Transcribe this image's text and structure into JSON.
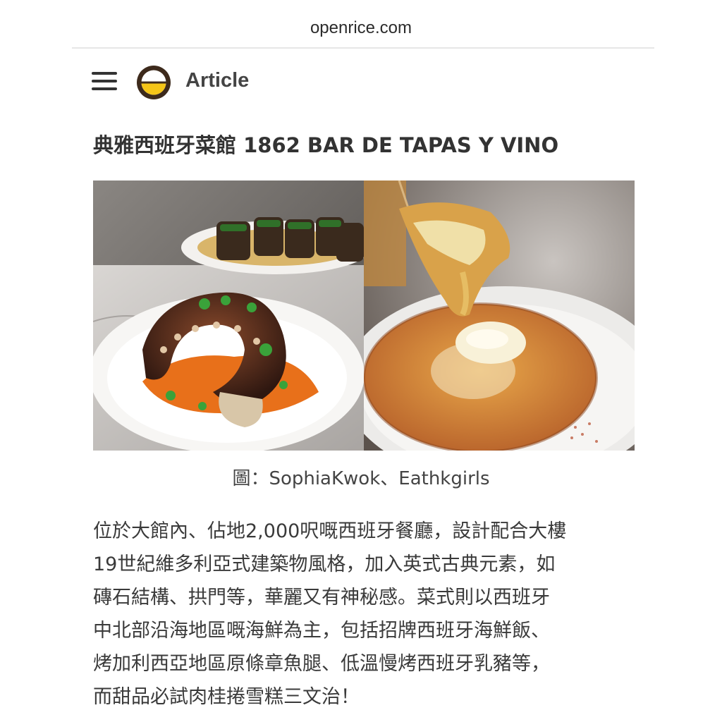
{
  "browser": {
    "url": "openrice.com"
  },
  "header": {
    "menu_icon": "hamburger-menu-icon",
    "logo_icon": "openrice-logo-icon",
    "title": "Article"
  },
  "article": {
    "headline": "典雅西班牙菜館 1862 BAR DE TAPAS Y VINO",
    "images": [
      {
        "subject": "grilled-octopus-dish"
      },
      {
        "subject": "spanish-tortilla-dish"
      }
    ],
    "caption": "圖：SophiaKwok、Eathkgirls",
    "paragraph_lines": [
      "位於大館內、佔地2,000呎嘅西班牙餐廳，設計配合大樓",
      "19世紀維多利亞式建築物風格，加入英式古典元素，如",
      "磚石結構、拱門等，華麗又有神秘感。菜式則以西班牙",
      "中北部沿海地區嘅海鮮為主，包括招牌西班牙海鮮飯、",
      "烤加利西亞地區原條章魚腿、低溫慢烤西班牙乳豬等，",
      "而甜品必試肉桂捲雪糕三文治！"
    ]
  },
  "colors": {
    "logo_ring": "#3d2a1c",
    "logo_fill": "#f5c518",
    "text": "#3a3a3a"
  }
}
